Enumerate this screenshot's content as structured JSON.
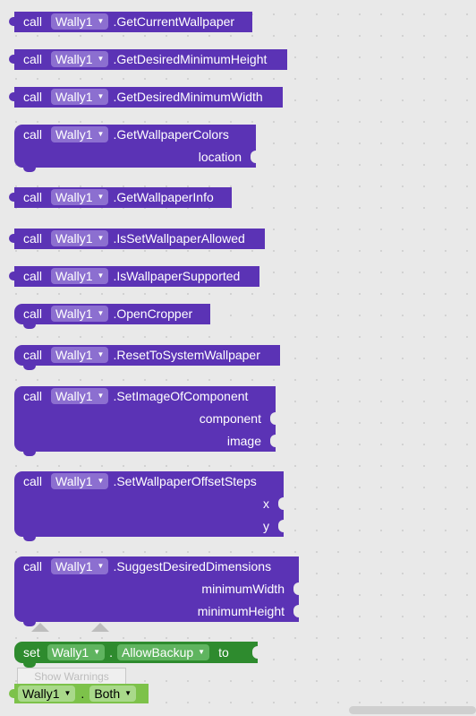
{
  "blocks": {
    "call_keyword": "call",
    "component": "Wally1",
    "methods": [
      ".GetCurrentWallpaper",
      ".GetDesiredMinimumHeight",
      ".GetDesiredMinimumWidth",
      ".GetWallpaperColors",
      ".GetWallpaperInfo",
      ".IsSetWallpaperAllowed",
      ".IsWallpaperSupported",
      ".OpenCropper",
      ".ResetToSystemWallpaper",
      ".SetImageOfComponent",
      ".SetWallpaperOffsetSteps",
      ".SuggestDesiredDimensions"
    ],
    "args": {
      "location": "location",
      "component": "component",
      "image": "image",
      "x": "x",
      "y": "y",
      "minimumWidth": "minimumWidth",
      "minimumHeight": "minimumHeight"
    },
    "setter": {
      "keyword": "set",
      "component": "Wally1",
      "dot": ".",
      "property": "AllowBackup",
      "to": "to"
    },
    "getter": {
      "component": "Wally1",
      "dot": ".",
      "property": "Both"
    }
  },
  "warnings_button": "Show Warnings",
  "colors": {
    "method_block": "#5b33b5",
    "setter_block": "#2e8b2e",
    "getter_block": "#7dc24a",
    "workspace": "#e9e9e9"
  },
  "icons": [
    "dropdown-arrow-icon"
  ]
}
